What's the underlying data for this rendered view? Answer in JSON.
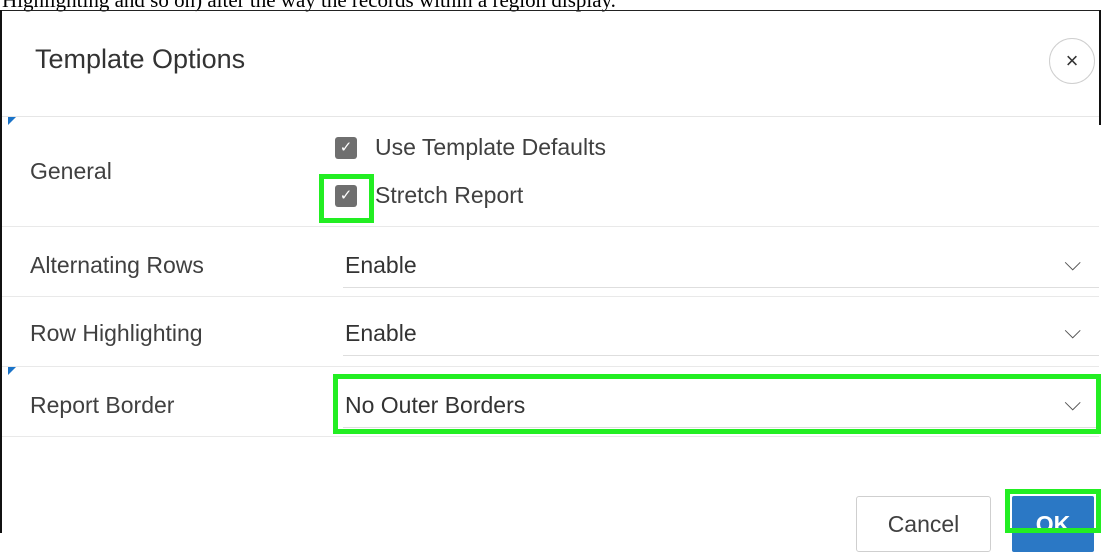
{
  "page": {
    "top_text": "Highlighting and so on) alter the way the records within a region display."
  },
  "dialog": {
    "title": "Template Options",
    "close_icon": "×",
    "general": {
      "label": "General",
      "options": [
        {
          "label": "Use Template Defaults",
          "checked": true
        },
        {
          "label": "Stretch Report",
          "checked": true
        }
      ]
    },
    "alternating_rows": {
      "label": "Alternating Rows",
      "value": "Enable"
    },
    "row_highlighting": {
      "label": "Row Highlighting",
      "value": "Enable"
    },
    "report_border": {
      "label": "Report Border",
      "value": "No Outer Borders"
    },
    "buttons": {
      "cancel": "Cancel",
      "ok": "OK"
    },
    "check_glyph": "✓",
    "chevron_glyph": "⌵"
  },
  "colors": {
    "highlight": "#22ee22",
    "primary": "#2b78c5",
    "marker": "#1a73c8",
    "checkbox": "#6f6f6f"
  }
}
